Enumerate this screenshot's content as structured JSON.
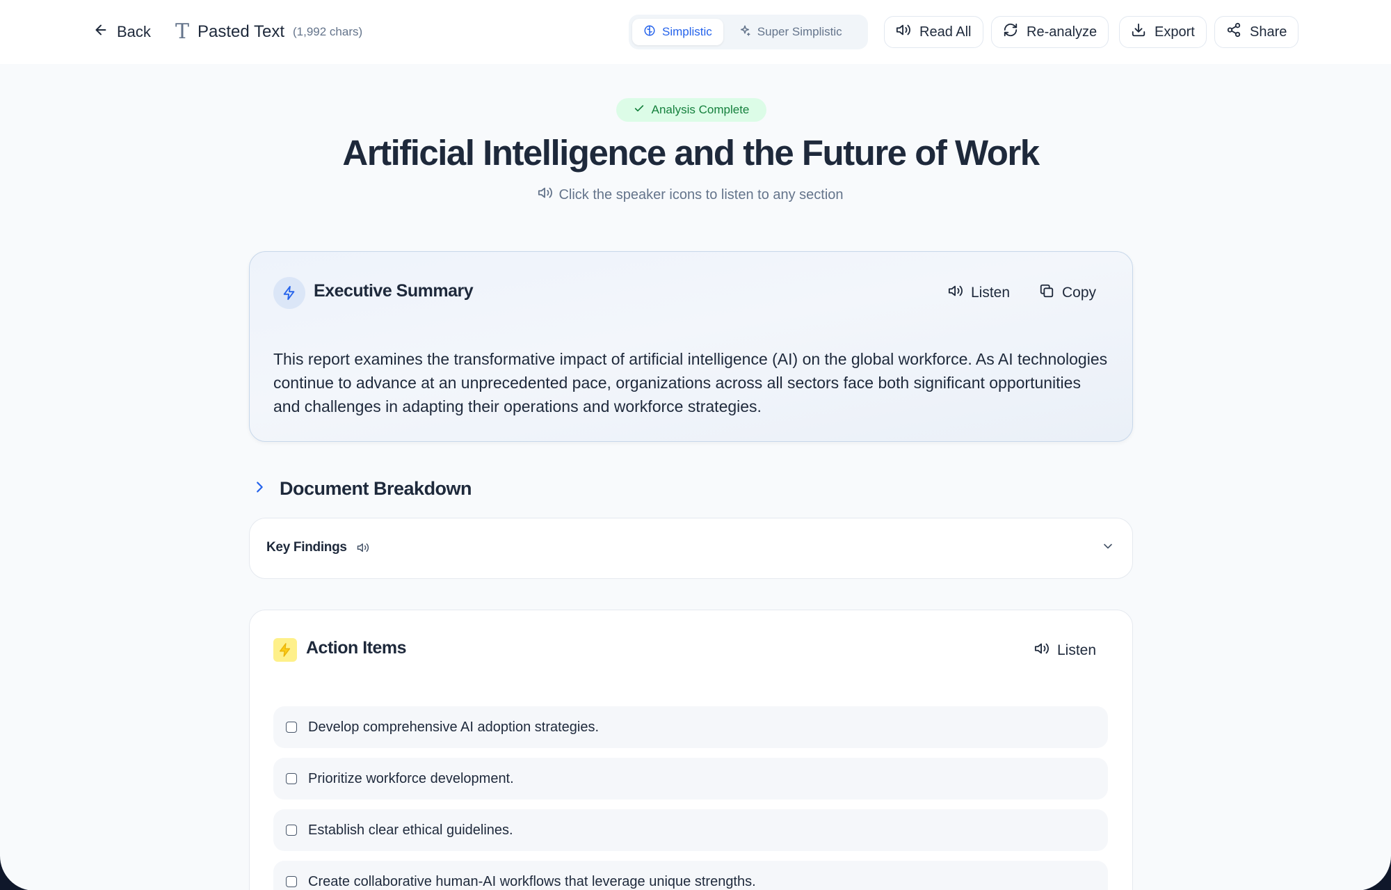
{
  "header": {
    "back_label": "Back",
    "doc_name": "Pasted Text",
    "doc_chars": "(1,992 chars)",
    "modes": [
      {
        "label": "Simplistic",
        "active": true,
        "icon": "brain-icon"
      },
      {
        "label": "Super Simplistic",
        "active": false,
        "icon": "sparkles-icon"
      }
    ],
    "actions": {
      "read_all": "Read All",
      "reanalyze": "Re-analyze",
      "export": "Export",
      "share": "Share"
    }
  },
  "status_badge": "Analysis Complete",
  "title": "Artificial Intelligence and the Future of Work",
  "subtitle": "Click the speaker icons to listen to any section",
  "summary": {
    "title": "Executive Summary",
    "listen_label": "Listen",
    "copy_label": "Copy",
    "text": "This report examines the transformative impact of artificial intelligence (AI) on the global workforce. As AI technologies continue to advance at an unprecedented pace, organizations across all sectors face both significant opportunities and challenges in adapting their operations and workforce strategies."
  },
  "breakdown": {
    "title": "Document Breakdown",
    "sections": [
      {
        "label": "Key Findings",
        "expanded": false
      }
    ]
  },
  "action_items": {
    "title": "Action Items",
    "listen_label": "Listen",
    "items": [
      "Develop comprehensive AI adoption strategies.",
      "Prioritize workforce development.",
      "Establish clear ethical guidelines.",
      "Create collaborative human-AI workflows that leverage unique strengths."
    ]
  },
  "colors": {
    "accent": "#2563eb",
    "badge_bg": "#dcfce7",
    "badge_text": "#15803d",
    "bolt_bg": "#fef08a"
  }
}
